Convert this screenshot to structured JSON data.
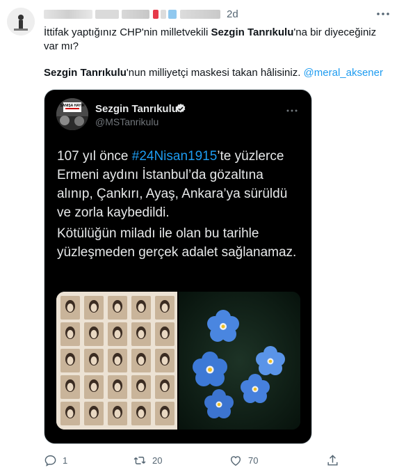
{
  "tweet": {
    "timestamp": "2d",
    "text_line1_part1": "İttifak yaptığınız CHP'nin milletvekili ",
    "text_line1_bold": "Sezgin Tanrıkulu",
    "text_line1_part2": "'na bir diyeceğiniz var mı?",
    "text_line2_bold": "Sezgin Tanrıkulu",
    "text_line2_part": "'nun milliyetçi maskesi takan hâlisiniz. ",
    "mention": "@meral_aksener"
  },
  "quoted_card": {
    "author_name": "Sezgin Tanrıkulu",
    "author_handle": "@MSTanrikulu",
    "avatar_sign_text": "SANIŞA HAYIR",
    "text1_part1": "107 yıl önce ",
    "text1_hashtag": "#24Nisan1915",
    "text1_part2": "’te yüzlerce Ermeni aydını İstanbul’da gözaltına alınıp, Çankırı, Ayaş, Ankara’ya sürüldü ve zorla kaybedildi.",
    "text2": "Kötülüğün miladı ile olan bu tarihle yüzleşmeden gerçek adalet sağlanamaz.",
    "media_left": "portraits-grid-image",
    "media_right": "forget-me-not-flowers-image"
  },
  "actions": {
    "reply_count": "1",
    "retweet_count": "20",
    "like_count": "70"
  },
  "icons": [
    "more-icon",
    "verified-icon",
    "reply-icon",
    "retweet-icon",
    "like-icon",
    "share-icon"
  ],
  "colors": {
    "accent": "#1d9bf0",
    "secondary_text": "#536471",
    "card_bg": "#000000"
  }
}
